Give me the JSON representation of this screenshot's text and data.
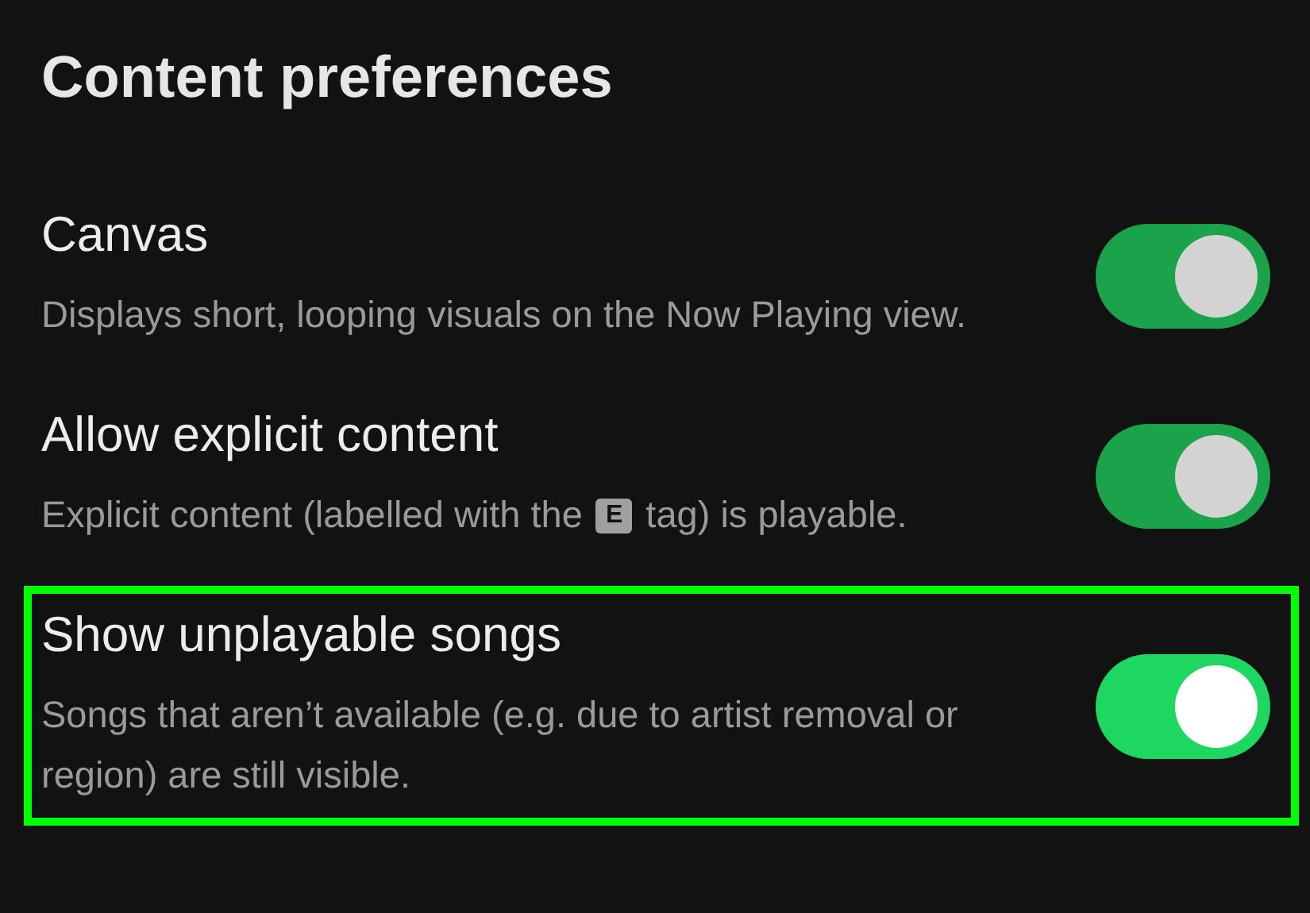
{
  "section_title": "Content preferences",
  "settings": [
    {
      "title": "Canvas",
      "description": [
        {
          "kind": "text",
          "text": "Displays short, looping visuals on the Now Playing view."
        }
      ],
      "on": true,
      "disabled": true,
      "highlighted": false
    },
    {
      "title": "Allow explicit content",
      "description": [
        {
          "kind": "text",
          "text": "Explicit content (labelled with the"
        },
        {
          "kind": "tag",
          "text": "E"
        },
        {
          "kind": "text",
          "text": "tag) is playable."
        }
      ],
      "on": true,
      "disabled": true,
      "highlighted": false
    },
    {
      "title": "Show unplayable songs",
      "description": [
        {
          "kind": "text",
          "text": "Songs that aren’t available (e.g. due to artist removal or region) are still visible."
        }
      ],
      "on": true,
      "disabled": false,
      "highlighted": true
    }
  ]
}
